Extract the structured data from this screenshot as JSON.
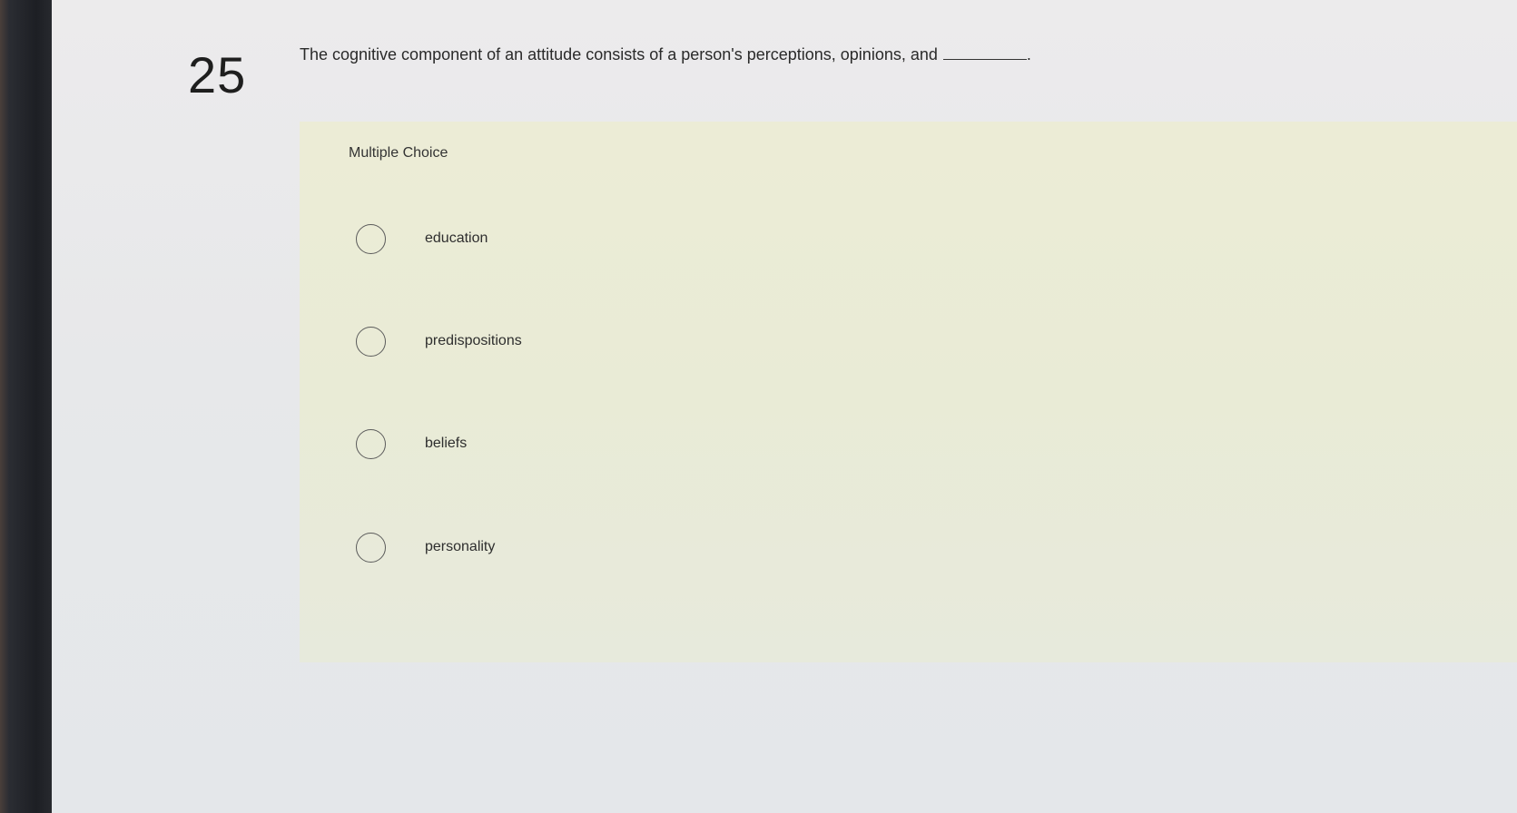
{
  "question": {
    "number": "25",
    "text": "The cognitive component of an attitude consists of a person's perceptions, opinions, and",
    "trailing": "."
  },
  "choices": {
    "type_label": "Multiple Choice",
    "options": [
      {
        "label": "education",
        "selected": false
      },
      {
        "label": "predispositions",
        "selected": false
      },
      {
        "label": "beliefs",
        "selected": false
      },
      {
        "label": "personality",
        "selected": false
      }
    ]
  },
  "colors": {
    "panel": "#eaebd6",
    "page": "#e8e9eb",
    "text": "#2a2a2a"
  }
}
